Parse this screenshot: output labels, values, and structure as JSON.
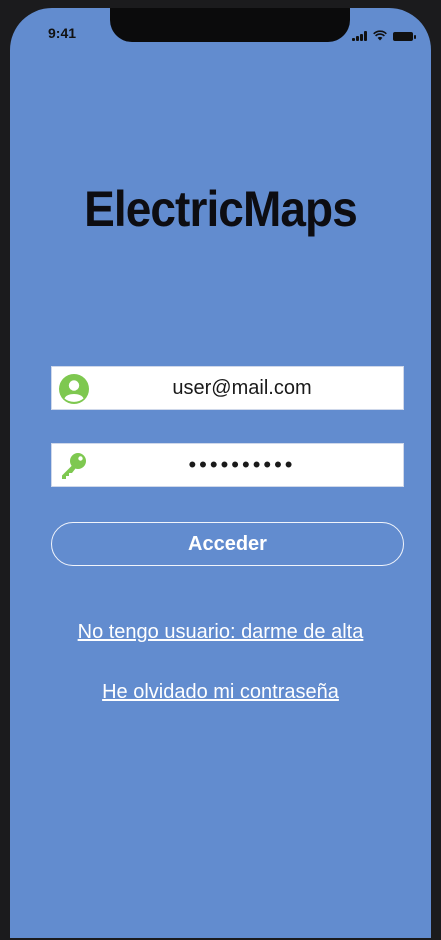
{
  "status_bar": {
    "time": "9:41"
  },
  "app": {
    "title": "ElectricMaps"
  },
  "login_form": {
    "email_value": "user@mail.com",
    "password_value": "••••••••••",
    "submit_label": "Acceder"
  },
  "links": {
    "register": "No tengo usuario: darme de alta",
    "forgot_password": "He olvidado mi contraseña"
  },
  "colors": {
    "background": "#628ccf",
    "icon_accent": "#7ec850",
    "title_text": "#0d0d12",
    "link_text": "#ffffff"
  },
  "icons": {
    "user": "user-circle-icon",
    "password": "key-icon"
  }
}
